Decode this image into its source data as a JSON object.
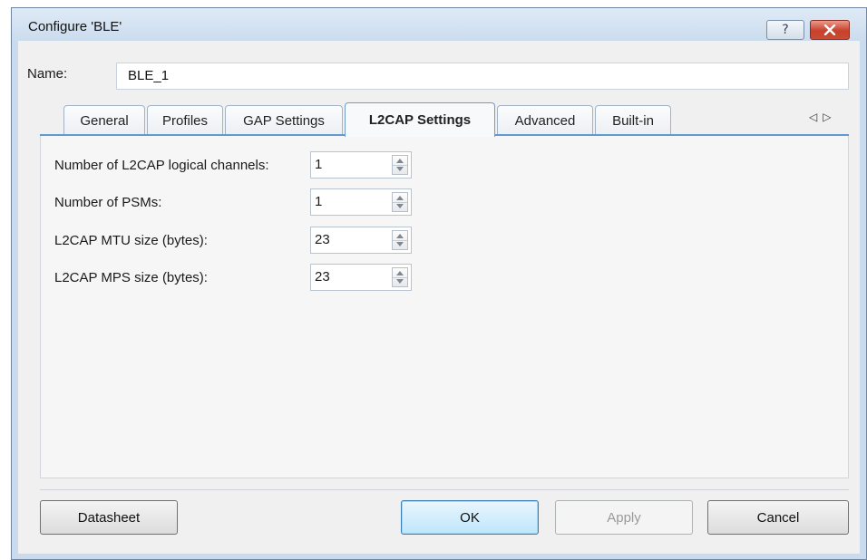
{
  "window": {
    "title": "Configure 'BLE'"
  },
  "title_buttons": {
    "help_icon": "question-mark",
    "close_icon": "close-x"
  },
  "name_field": {
    "label": "Name:",
    "value": "BLE_1"
  },
  "tabs": [
    {
      "label": "General",
      "active": false
    },
    {
      "label": "Profiles",
      "active": false
    },
    {
      "label": "GAP Settings",
      "active": false
    },
    {
      "label": "L2CAP Settings",
      "active": true
    },
    {
      "label": "Advanced",
      "active": false
    },
    {
      "label": "Built-in",
      "active": false
    }
  ],
  "tab_scroll": {
    "left_icon": "triangle-left",
    "right_icon": "triangle-right"
  },
  "fields": [
    {
      "label": "Number of L2CAP logical channels:",
      "value": "1"
    },
    {
      "label": "Number of PSMs:",
      "value": "1"
    },
    {
      "label": "L2CAP MTU size (bytes):",
      "value": "23"
    },
    {
      "label": "L2CAP MPS size (bytes):",
      "value": "23"
    }
  ],
  "buttons": {
    "datasheet": "Datasheet",
    "ok": "OK",
    "apply": "Apply",
    "cancel": "Cancel"
  },
  "colors": {
    "titlebar": "#cbdcee",
    "active_tab_line": "#5f9ad1",
    "close_button": "#c8402c"
  }
}
